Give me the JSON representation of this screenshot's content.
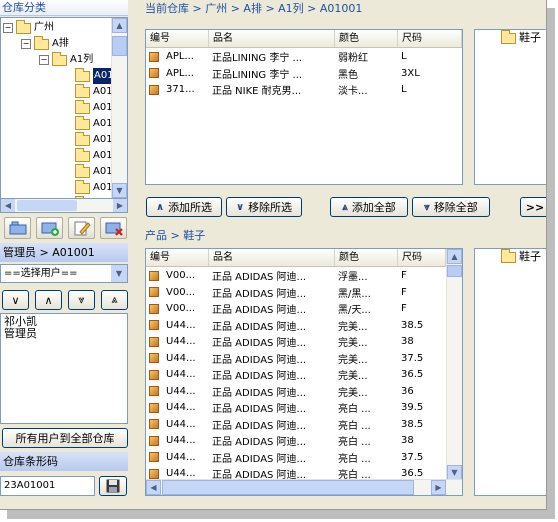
{
  "left": {
    "warehouse_header": "仓库分类",
    "tree": {
      "root": "广州",
      "row_a": "A排",
      "col_a1": "A1列",
      "cells": [
        "A01",
        "A01",
        "A01",
        "A01",
        "A01",
        "A01",
        "A01",
        "A01",
        "A01",
        "A01",
        "A01"
      ]
    },
    "toolbar_icons": [
      "add-folder-icon",
      "add-item-icon",
      "edit-icon",
      "delete-icon"
    ],
    "admin_header": "管理员 > A01001",
    "user_select_value": "==选择用户==",
    "user_list": "祁小凯\n管理员",
    "all_users_button": "所有用户到全部仓库",
    "barcode_header": "仓库条形码",
    "barcode_value": "23A01001"
  },
  "top": {
    "breadcrumb": "当前仓库 > 广州 > A排 > A1列 > A01001",
    "columns": [
      "编号",
      "品名",
      "颜色",
      "尺码"
    ],
    "rows": [
      [
        "APL...",
        "正品LINING 李宁 ...",
        "弱粉红",
        "L"
      ],
      [
        "APL...",
        "正品LINING 李宁 ...",
        "黑色",
        "3XL"
      ],
      [
        "371...",
        "正品 NIKE 耐克男...",
        "淡卡...",
        "L"
      ]
    ],
    "folder_label": "鞋子"
  },
  "actions": {
    "add_selected": "添加所选",
    "remove_selected": "移除所选",
    "add_all": "添加全部",
    "remove_all": "移除全部",
    "more": ">>"
  },
  "bottom": {
    "breadcrumb": "产品 > 鞋子",
    "columns": [
      "编号",
      "品名",
      "颜色",
      "尺码"
    ],
    "rows": [
      [
        "V00...",
        "正品 ADIDAS 阿迪...",
        "浮墨...",
        "F"
      ],
      [
        "V00...",
        "正品 ADIDAS 阿迪...",
        "黑/黑...",
        "F"
      ],
      [
        "V00...",
        "正品 ADIDAS 阿迪...",
        "黑/天...",
        "F"
      ],
      [
        "U44...",
        "正品 ADIDAS 阿迪...",
        "完美...",
        "38.5"
      ],
      [
        "U44...",
        "正品 ADIDAS 阿迪...",
        "完美...",
        "38"
      ],
      [
        "U44...",
        "正品 ADIDAS 阿迪...",
        "完美...",
        "37.5"
      ],
      [
        "U44...",
        "正品 ADIDAS 阿迪...",
        "完美...",
        "36.5"
      ],
      [
        "U44...",
        "正品 ADIDAS 阿迪...",
        "完美...",
        "36"
      ],
      [
        "U44...",
        "正品  ADIDAS  阿迪...",
        "亮白 ...",
        "39.5"
      ],
      [
        "U44...",
        "正品  ADIDAS  阿迪...",
        "亮白 ...",
        "38.5"
      ],
      [
        "U44...",
        "正品  ADIDAS  阿迪...",
        "亮白 ...",
        "38"
      ],
      [
        "U44...",
        "正品  ADIDAS  阿迪...",
        "亮白 ...",
        "37.5"
      ],
      [
        "U44...",
        "正品  ADIDAS  阿迪...",
        "亮白 ...",
        "36.5"
      ]
    ],
    "folder_label": "鞋子"
  }
}
